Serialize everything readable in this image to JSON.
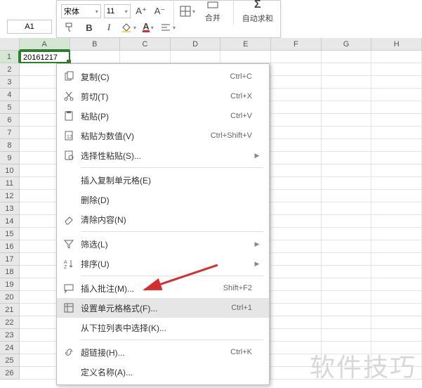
{
  "toolbar": {
    "font_name": "宋体",
    "font_size": "11",
    "btn_bold": "B",
    "btn_italic": "I",
    "btn_underline": "⎁",
    "btn_font_bigger": "A⁺",
    "btn_font_smaller": "A⁻",
    "merge_label": "合并",
    "autosum_label": "自动求和"
  },
  "namebox": {
    "value": "A1"
  },
  "columns": [
    "A",
    "B",
    "C",
    "D",
    "E",
    "F",
    "G",
    "H"
  ],
  "row_count": 26,
  "active_cell": {
    "value": "20161217"
  },
  "menu": {
    "items": [
      {
        "key": "copy",
        "label": "复制(C)",
        "shortcut": "Ctrl+C",
        "icon": "copy-icon"
      },
      {
        "key": "cut",
        "label": "剪切(T)",
        "shortcut": "Ctrl+X",
        "icon": "cut-icon"
      },
      {
        "key": "paste",
        "label": "粘贴(P)",
        "shortcut": "Ctrl+V",
        "icon": "paste-icon"
      },
      {
        "key": "paste-val",
        "label": "粘贴为数值(V)",
        "shortcut": "Ctrl+Shift+V",
        "icon": "paste-value-icon"
      },
      {
        "key": "paste-spec",
        "label": "选择性粘贴(S)...",
        "shortcut": "",
        "icon": "paste-special-icon",
        "submenu": true,
        "sep_after": true
      },
      {
        "key": "ins-copied",
        "label": "插入复制单元格(E)",
        "shortcut": "",
        "icon": ""
      },
      {
        "key": "delete",
        "label": "删除(D)",
        "shortcut": "",
        "icon": ""
      },
      {
        "key": "clear",
        "label": "清除内容(N)",
        "shortcut": "",
        "icon": "eraser-icon",
        "sep_after": true
      },
      {
        "key": "filter",
        "label": "筛选(L)",
        "shortcut": "",
        "icon": "filter-icon",
        "submenu": true
      },
      {
        "key": "sort",
        "label": "排序(U)",
        "shortcut": "",
        "icon": "sort-icon",
        "submenu": true,
        "sep_after": true
      },
      {
        "key": "comment",
        "label": "插入批注(M)...",
        "shortcut": "Shift+F2",
        "icon": "comment-icon"
      },
      {
        "key": "format",
        "label": "设置单元格格式(F)...",
        "shortcut": "Ctrl+1",
        "icon": "format-cell-icon",
        "hover": true
      },
      {
        "key": "pick-list",
        "label": "从下拉列表中选择(K)...",
        "shortcut": "",
        "icon": "",
        "sep_after": true
      },
      {
        "key": "hyperlink",
        "label": "超链接(H)...",
        "shortcut": "Ctrl+K",
        "icon": "link-icon"
      },
      {
        "key": "def-name",
        "label": "定义名称(A)...",
        "shortcut": "",
        "icon": ""
      }
    ]
  },
  "watermark": "软件技巧"
}
